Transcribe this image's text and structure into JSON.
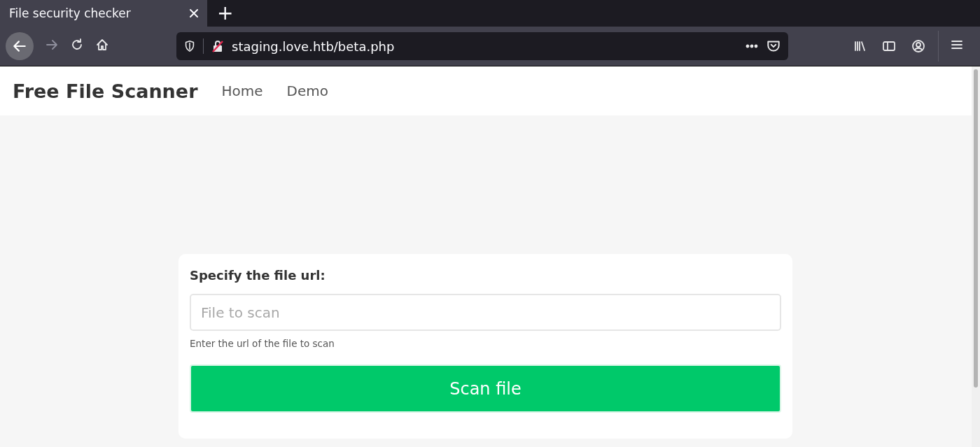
{
  "browser": {
    "tabs": [
      {
        "title": "File security checker",
        "selected": true
      }
    ],
    "new_tab": "+",
    "url": "staging.love.htb/beta.php"
  },
  "navbar": {
    "brand": "Free File Scanner",
    "links": [
      "Home",
      "Demo"
    ]
  },
  "form": {
    "label": "Specify the file url:",
    "field": {
      "placeholder": "File to scan"
    },
    "help": "Enter the url of the file to scan",
    "button": "Scan file"
  }
}
